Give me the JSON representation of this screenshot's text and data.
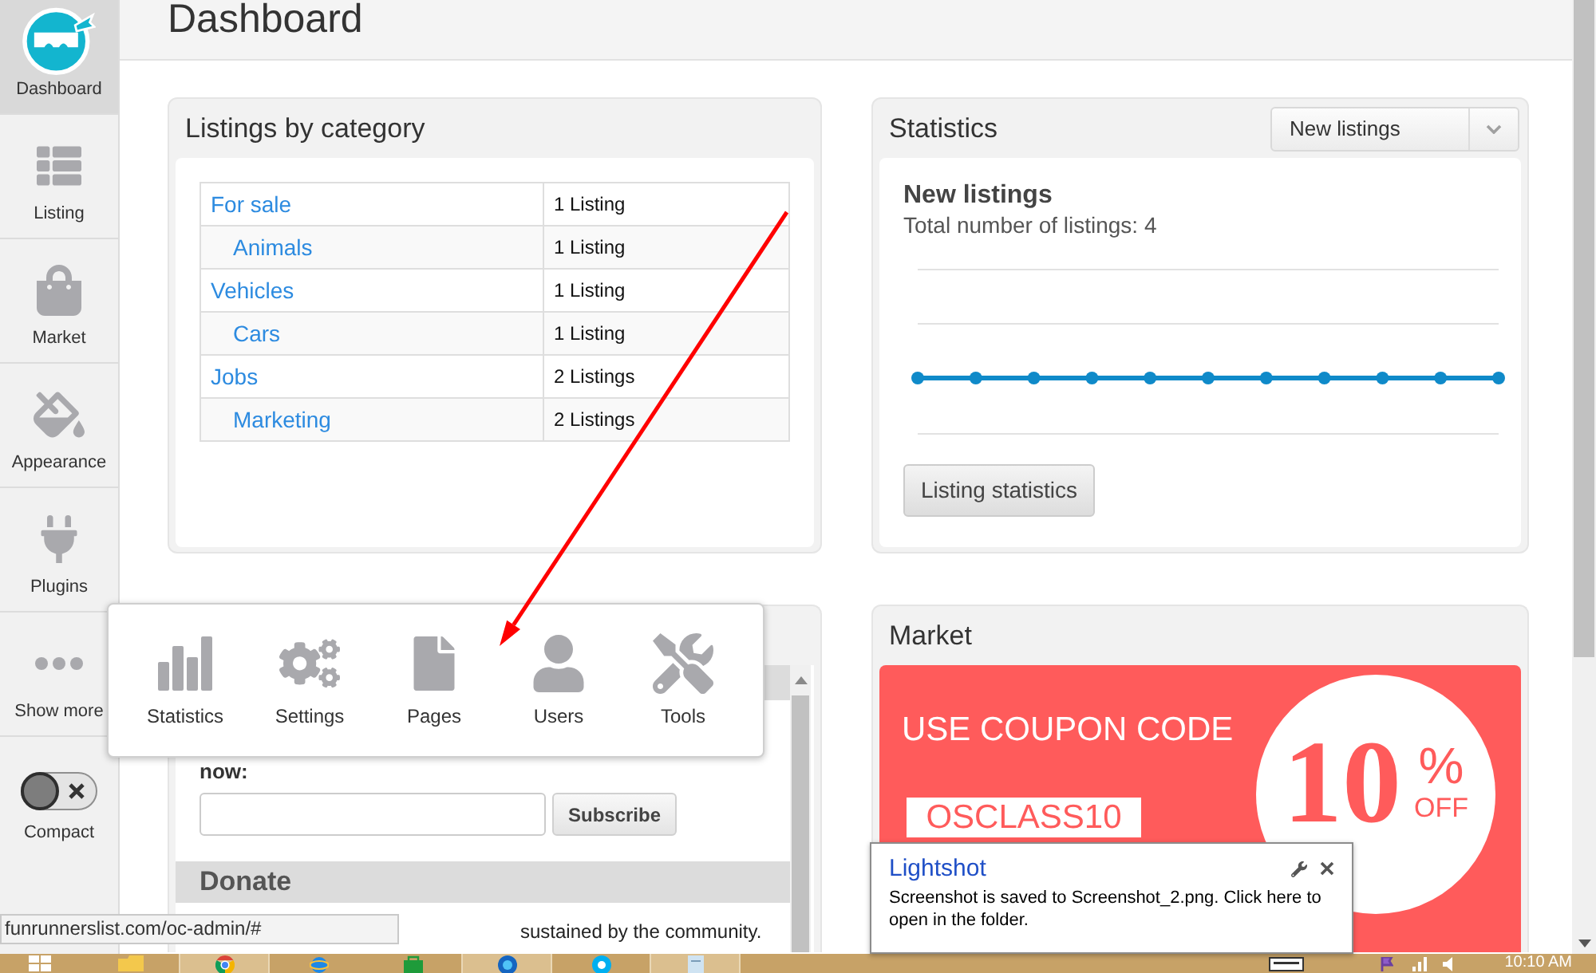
{
  "sidebar": {
    "items": [
      {
        "label": "Dashboard",
        "selected": true
      },
      {
        "label": "Listing",
        "selected": false
      },
      {
        "label": "Market",
        "selected": false
      },
      {
        "label": "Appearance",
        "selected": false
      },
      {
        "label": "Plugins",
        "selected": false
      },
      {
        "label": "Show more",
        "selected": false
      }
    ],
    "compact": {
      "label": "Compact",
      "on": false
    }
  },
  "header": {
    "title": "Dashboard"
  },
  "listings_by_category": {
    "title": "Listings by category",
    "rows": [
      {
        "category": "For sale",
        "count": "1 Listing",
        "children": [
          {
            "category": "Animals",
            "count": "1 Listing"
          }
        ]
      },
      {
        "category": "Vehicles",
        "count": "1 Listing",
        "children": [
          {
            "category": "Cars",
            "count": "1 Listing"
          }
        ]
      },
      {
        "category": "Jobs",
        "count": "2 Listings",
        "children": [
          {
            "category": "Marketing",
            "count": "2 Listings"
          }
        ]
      }
    ]
  },
  "statistics": {
    "title": "Statistics",
    "select": {
      "value": "New listings"
    },
    "heading": "New listings",
    "total": "Total number of listings: 4",
    "button": "Listing statistics"
  },
  "more_menu": {
    "items": [
      {
        "label": "Statistics"
      },
      {
        "label": "Settings"
      },
      {
        "label": "Pages"
      },
      {
        "label": "Users"
      },
      {
        "label": "Tools"
      }
    ]
  },
  "newsletter": {
    "text": "now:",
    "button": "Subscribe",
    "donate": {
      "title": "Donate",
      "text": "sustained by the community."
    }
  },
  "market": {
    "title": "Market",
    "banner": {
      "headline": "USE COUPON CODE",
      "code": "OSCLASS10",
      "discount": "10",
      "unit": "%",
      "off": "OFF"
    }
  },
  "status_url": "funrunnerslist.com/oc-admin/#",
  "notification": {
    "title": "Lightshot",
    "message": "Screenshot is saved to Screenshot_2.png. Click here to open in the folder."
  },
  "taskbar": {
    "apps": [
      {
        "running": false
      },
      {
        "running": true
      },
      {
        "running": false
      },
      {
        "running": false
      },
      {
        "running": true
      },
      {
        "running": false
      },
      {
        "running": true
      }
    ],
    "clock": "10:10 AM"
  }
}
